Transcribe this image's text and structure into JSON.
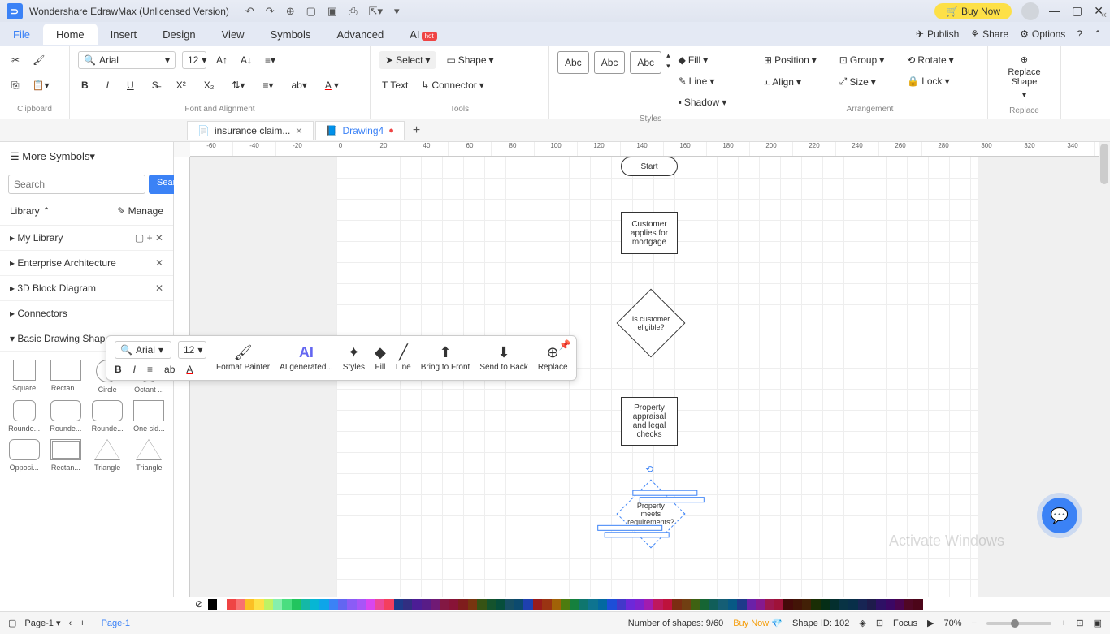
{
  "title": "Wondershare EdrawMax (Unlicensed Version)",
  "buy_now": "Buy Now",
  "menu": {
    "file": "File",
    "home": "Home",
    "insert": "Insert",
    "design": "Design",
    "view": "View",
    "symbols": "Symbols",
    "advanced": "Advanced",
    "ai": "AI",
    "hot": "hot",
    "publish": "Publish",
    "share": "Share",
    "options": "Options"
  },
  "ribbon": {
    "clipboard": "Clipboard",
    "font_align": "Font and Alignment",
    "tools": "Tools",
    "styles": "Styles",
    "arrangement": "Arrangement",
    "replace": "Replace",
    "font_name": "Arial",
    "font_size": "12",
    "select": "Select",
    "shape": "Shape",
    "text": "Text",
    "connector": "Connector",
    "abc": "Abc",
    "fill": "Fill",
    "line": "Line",
    "shadow": "Shadow",
    "position": "Position",
    "align": "Align",
    "group": "Group",
    "size": "Size",
    "rotate": "Rotate",
    "lock": "Lock",
    "replace_shape": "Replace\nShape"
  },
  "tabs": {
    "t1": "insurance claim...",
    "t2": "Drawing4"
  },
  "panel": {
    "more_symbols": "More Symbols",
    "search_placeholder": "Search",
    "search_btn": "Search",
    "library": "Library",
    "manage": "Manage",
    "sections": [
      "My Library",
      "Enterprise Architecture",
      "3D Block Diagram",
      "Connectors",
      "Basic Drawing Shap..."
    ],
    "shapes": [
      "Square",
      "Rectan...",
      "Circle",
      "Octant ...",
      "Rounde...",
      "Rounde...",
      "Rounde...",
      "One sid...",
      "Opposi...",
      "Rectan...",
      "Triangle",
      "Triangle"
    ]
  },
  "ruler_h": [
    "-60",
    "-40",
    "-20",
    "0",
    "20",
    "40",
    "60",
    "80",
    "100",
    "120",
    "140",
    "160",
    "180",
    "200",
    "220",
    "240",
    "260",
    "280",
    "300",
    "320",
    "340"
  ],
  "canvas": {
    "start": "Start",
    "n1": "Customer applies for mortgage",
    "n2": "Is customer eligible?",
    "n3": "Property appraisal and legal checks",
    "n4": "Property meets requirements?"
  },
  "float": {
    "font": "Arial",
    "size": "12",
    "format_painter": "Format Painter",
    "ai_gen": "AI generated...",
    "styles": "Styles",
    "fill": "Fill",
    "line": "Line",
    "bring_front": "Bring to Front",
    "send_back": "Send to Back",
    "replace": "Replace"
  },
  "status": {
    "page1": "Page-1",
    "shapes_count": "Number of shapes: 9/60",
    "buy_now": "Buy Now",
    "shape_id": "Shape ID: 102",
    "focus": "Focus",
    "zoom": "70%"
  },
  "watermark": "Activate Windows",
  "colors": [
    "#000",
    "#fff",
    "#ef4444",
    "#f87171",
    "#fbbf24",
    "#fde047",
    "#bef264",
    "#86efac",
    "#4ade80",
    "#22c55e",
    "#14b8a6",
    "#06b6d4",
    "#0ea5e9",
    "#3b82f6",
    "#6366f1",
    "#8b5cf6",
    "#a855f7",
    "#d946ef",
    "#ec4899",
    "#f43f5e",
    "#1e3a8a",
    "#312e81",
    "#4c1d95",
    "#581c87",
    "#701a75",
    "#831843",
    "#881337",
    "#7f1d1d",
    "#78350f",
    "#365314",
    "#14532d",
    "#064e3b",
    "#164e63",
    "#0c4a6e",
    "#1e40af",
    "#991b1b",
    "#9a3412",
    "#a16207",
    "#4d7c0f",
    "#15803d",
    "#0f766e",
    "#0e7490",
    "#0369a1",
    "#1d4ed8",
    "#4338ca",
    "#6d28d9",
    "#7e22ce",
    "#a21caf",
    "#be185d",
    "#be123c",
    "#7c2d12",
    "#713f12",
    "#3f6212",
    "#166534",
    "#115e59",
    "#155e75",
    "#075985",
    "#1e3a8a",
    "#6b21a8",
    "#86198f",
    "#9d174d",
    "#9f1239",
    "#450a0a",
    "#431407",
    "#422006",
    "#1a2e05",
    "#052e16",
    "#042f2e",
    "#083344",
    "#082f49",
    "#172554",
    "#1e1b4b",
    "#2e1065",
    "#3b0764",
    "#4a044e",
    "#500724",
    "#4c0519"
  ]
}
